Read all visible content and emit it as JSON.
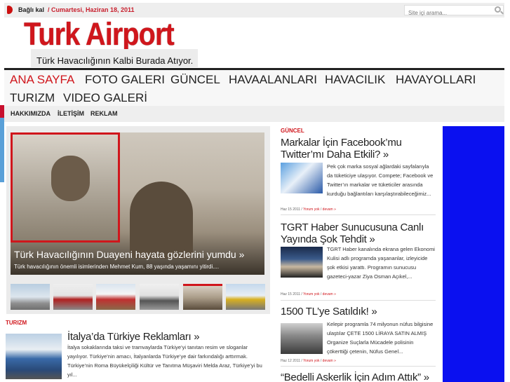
{
  "topbar": {
    "connect_label": "Bağlı kal",
    "date": "/ Cumartesi, Haziran 18, 2011",
    "search_placeholder": "Site içi arama..."
  },
  "brand": {
    "logo_text": "Turk Airport",
    "tagline": "Türk Havacılığının Kalbi Burada Atıyor.",
    "accent_color": "#d0161c"
  },
  "nav": {
    "items": [
      {
        "label": "ANA SAYFA"
      },
      {
        "label": "FOTO GALERI"
      },
      {
        "label": "GÜNCEL"
      },
      {
        "label": "HAVAALANLARI"
      },
      {
        "label": "HAVACILIK"
      },
      {
        "label": "HAVAYOLLARI"
      },
      {
        "label": "TURIZM"
      },
      {
        "label": "VIDEO GALERİ"
      }
    ]
  },
  "subnav": {
    "items": [
      {
        "label": "HAKKIMIZDA"
      },
      {
        "label": "İLETİŞİM"
      },
      {
        "label": "REKLAM"
      }
    ]
  },
  "slider": {
    "title": "Türk Havacılığının Duayeni hayata gözlerini yumdu »",
    "description": "Türk havacılığının önemli isimlerinden Mehmet Kum, 88 yaşında yaşamını yitirdi....",
    "thumbnails": [
      {
        "icon": "airliner-photo"
      },
      {
        "icon": "airliner-photo"
      },
      {
        "icon": "building-photo"
      },
      {
        "icon": "prop-plane-photo"
      },
      {
        "icon": "pilot-photo"
      },
      {
        "icon": "airliner-photo"
      }
    ]
  },
  "turizm": {
    "section": "TURIZM",
    "title": "İtalya’da Türkiye Reklamları »",
    "body": "İtalya sokaklarında taksi ve tramvaylarda Türkiye’yi tanıtan resim ve sloganlar yayılıyor. Türkiye’nin amacı, İtalyanlarda Türkiye’ye dair farkındalığı arttırmak. Türkiye’nin Roma Büyükelçiliği Kültür ve Tanıtma Müşaviri Melda Araz, Türkiye’yi bu yıl..."
  },
  "guncel": {
    "section": "GÜNCEL",
    "articles": [
      {
        "title": "Markalar İçin Facebook’mu Twitter’mı Daha Etkili? »",
        "body": "Pek çok marka sosyal ağlardaki sayfalarıyla da tüketiciye ulaşıyor. Compete; Facebook ve Twitter’ın markalar ve tüketiciler arasında kurduğu bağlantıları karşılaştırabileceğimiz...",
        "date": "Haz 15 2011",
        "comments": "Yorum yok",
        "more": "devam »"
      },
      {
        "title": "TGRT Haber Sunucusuna Canlı Yayında Şok Tehdit »",
        "body": "TGRT Haber kanalında ekrana gelen Ekonomi Kulisi adlı programda yaşananlar, izleyicide şok etkisi yarattı. Programın sunucusu gazeteci-yazar Ziya Osman Açıkel,...",
        "date": "Haz 15 2011",
        "comments": "Yorum yok",
        "more": "devam »"
      },
      {
        "title": "1500 TL’ye Satıldık! »",
        "body": "Kelepir programla 74 milyonun nüfus bilgisine ulaştılar ÇETE 1500 LİRAYA SATIN ALMIŞ Organize Suçlarla Mücadele polisinin çökerttiği çetenin, Nüfus Genel...",
        "date": "Haz 12 2011",
        "comments": "Yorum yok",
        "more": "devam »"
      },
      {
        "title": "“Bedelli Askerlik İçin Adım Attık” »"
      }
    ]
  }
}
